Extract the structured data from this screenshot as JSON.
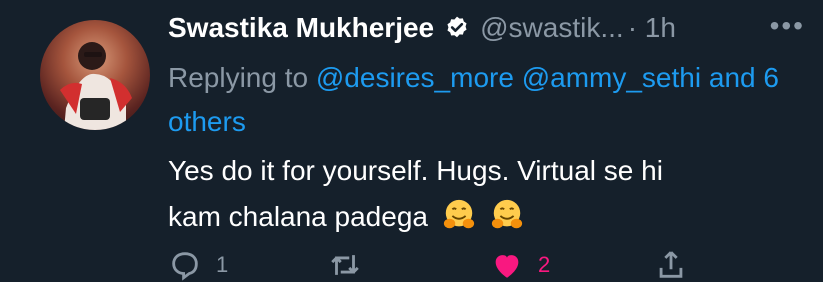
{
  "tweet": {
    "author_name": "Swastika Mukherjee",
    "handle": "@swastik...",
    "time": "· 1h",
    "more_label": "•••",
    "replying_prefix": "Replying to",
    "reply_to": [
      "@desires_more",
      "@ammy_sethi"
    ],
    "reply_others": "and 6 others",
    "text_line1": "Yes do it for yourself. Hugs. Virtual se hi",
    "text_line2": "kam chalana padega",
    "emojis": [
      "hugging-face",
      "hugging-face"
    ],
    "actions": {
      "reply_count": "1",
      "retweet_count": "",
      "like_count": "2"
    }
  },
  "colors": {
    "background": "#15202b",
    "secondary_text": "#8b98a5",
    "link": "#1d9bf0",
    "like": "#f91880"
  }
}
